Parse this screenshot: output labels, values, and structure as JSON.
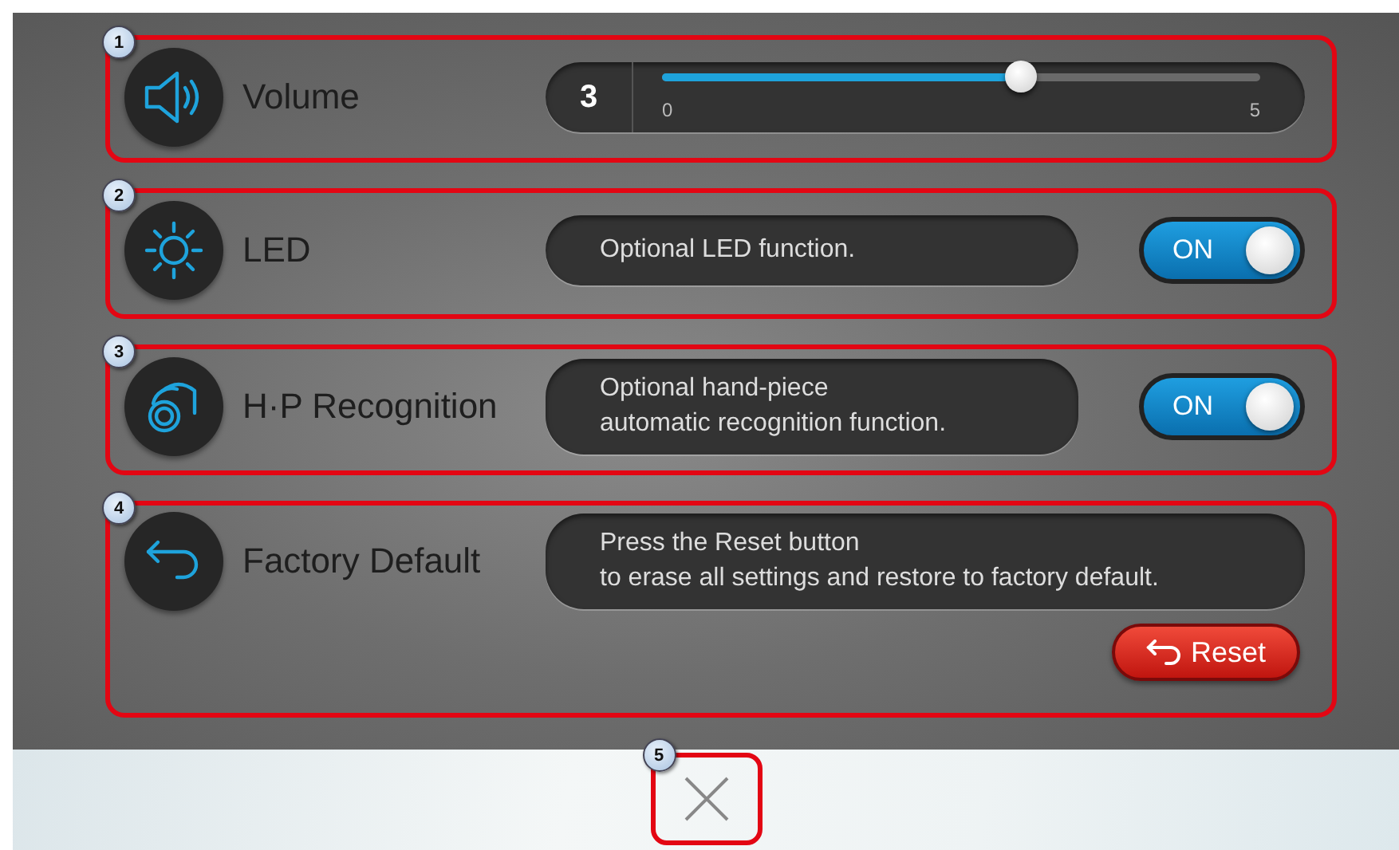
{
  "settings": [
    {
      "kind": "slider",
      "callout": "1",
      "label": "Volume",
      "value": "3",
      "min_label": "0",
      "max_label": "5",
      "level": 0.6
    },
    {
      "kind": "toggle",
      "callout": "2",
      "label": "LED",
      "description": "Optional LED function.",
      "on": true,
      "toggle_text": "ON"
    },
    {
      "kind": "toggle",
      "callout": "3",
      "label": "H·P Recognition",
      "description": "Optional hand-piece\nautomatic recognition function.",
      "on": true,
      "toggle_text": "ON"
    },
    {
      "kind": "reset",
      "callout": "4",
      "label": "Factory Default",
      "description": "Press the Reset button\nto erase all settings and restore to factory default.",
      "button": "Reset"
    }
  ],
  "close": {
    "callout": "5"
  }
}
